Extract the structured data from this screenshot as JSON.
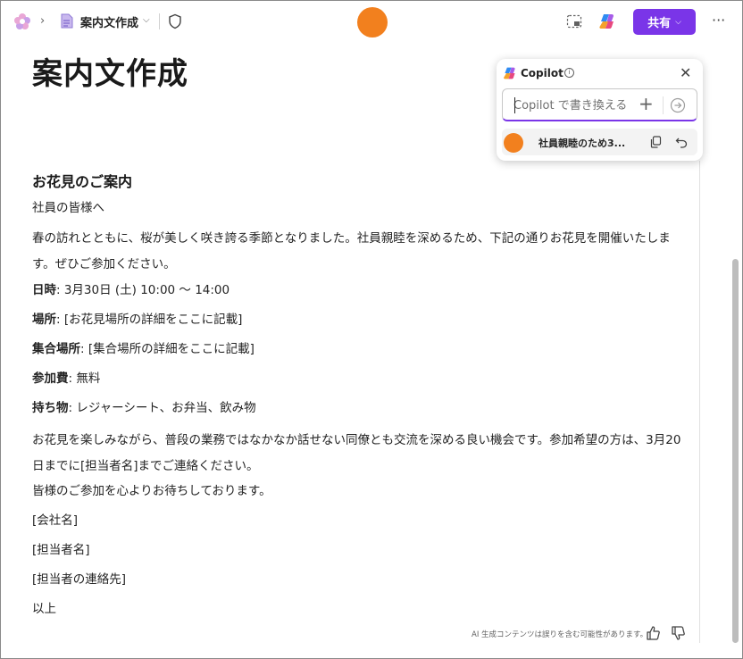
{
  "topbar": {
    "doc_title": "案内文作成",
    "share_label": "共有",
    "more_label": "···",
    "icons": [
      "app-logo-icon",
      "chevron-right-icon",
      "page-icon",
      "chevron-down-icon",
      "shield-icon",
      "select-area-icon",
      "copilot-icon",
      "more-icon"
    ],
    "accent_color": "#7a35e8",
    "avatar_color": "#f2801e"
  },
  "document": {
    "title": "案内文作成",
    "heading": "お花見のご案内",
    "greeting": "社員の皆様へ",
    "intro": "春の訪れとともに、桜が美しく咲き誇る季節となりました。社員親睦を深めるため、下記の通りお花見を開催いたします。ぜひご参加ください。",
    "details": [
      {
        "label": "日時",
        "value": ": 3月30日 (土) 10:00 ～ 14:00"
      },
      {
        "label": "場所",
        "value": ": [お花見場所の詳細をここに記載]"
      },
      {
        "label": "集合場所",
        "value": ": [集合場所の詳細をここに記載]"
      },
      {
        "label": "参加費",
        "value": ": 無料"
      },
      {
        "label": "持ち物",
        "value": ": レジャーシート、お弁当、飲み物"
      }
    ],
    "closing": "お花見を楽しみながら、普段の業務ではなかなか話せない同僚とも交流を深める良い機会です。参加希望の方は、3月20日までに[担当者名]までご連絡ください。",
    "sign_off": "皆様のご参加を心よりお待ちしております。",
    "company": "[会社名]",
    "contact_name": "[担当者名]",
    "contact_info": "[担当者の連絡先]",
    "end": "以上"
  },
  "footer": {
    "disclaimer": "AI 生成コンテンツは誤りを含む可能性があります。"
  },
  "copilot": {
    "title": "Copilot",
    "info_label": "i",
    "input_placeholder": "Copilot で書き換える",
    "plus_label": "+",
    "close_label": "✕",
    "history_item": "社員親睦のため3..."
  }
}
